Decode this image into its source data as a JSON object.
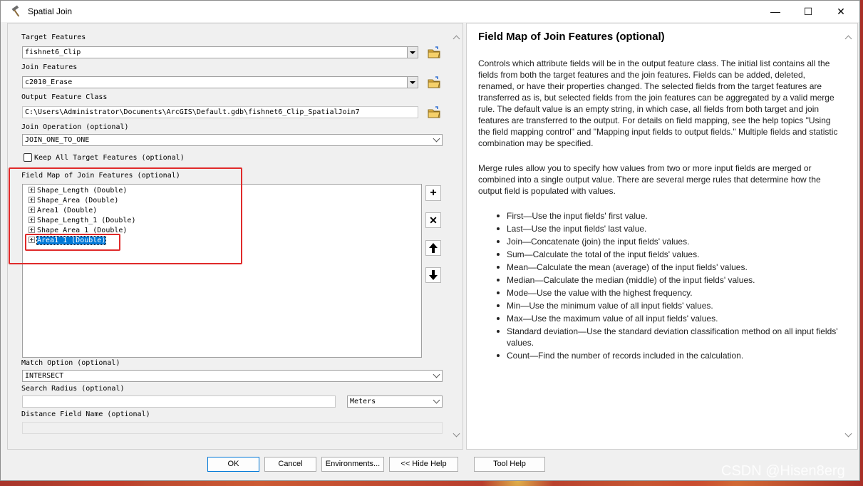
{
  "window": {
    "title": "Spatial Join",
    "controls": {
      "minimize": "—",
      "maximize": "☐",
      "close": "✕"
    }
  },
  "form": {
    "target_features": {
      "label": "Target Features",
      "value": "fishnet6_Clip"
    },
    "join_features": {
      "label": "Join Features",
      "value": "c2010_Erase"
    },
    "output_feature_class": {
      "label": "Output Feature Class",
      "value": "C:\\Users\\Administrator\\Documents\\ArcGIS\\Default.gdb\\fishnet6_Clip_SpatialJoin7"
    },
    "join_operation": {
      "label": "Join Operation (optional)",
      "value": "JOIN_ONE_TO_ONE"
    },
    "keep_all": {
      "label": "Keep All Target Features (optional)",
      "checked": false
    },
    "field_map": {
      "label": "Field Map of Join Features (optional)",
      "items": [
        {
          "text": "Shape_Length (Double)",
          "selected": false
        },
        {
          "text": "Shape_Area (Double)",
          "selected": false
        },
        {
          "text": "Area1 (Double)",
          "selected": false
        },
        {
          "text": "Shape_Length_1 (Double)",
          "selected": false
        },
        {
          "text": "Shape_Area_1 (Double)",
          "selected": false
        },
        {
          "text": "Area1_1 (Double)",
          "selected": true
        }
      ],
      "buttons": {
        "add": "+",
        "remove": "✕",
        "up": "🡅",
        "down": "🡇"
      }
    },
    "match_option": {
      "label": "Match Option (optional)",
      "value": "INTERSECT"
    },
    "search_radius": {
      "label": "Search Radius (optional)",
      "value": "",
      "unit": "Meters"
    },
    "distance_field": {
      "label": "Distance Field Name (optional)",
      "value": ""
    }
  },
  "help": {
    "title": "Field Map of Join Features (optional)",
    "para1": "Controls which attribute fields will be in the output feature class. The initial list contains all the fields from both the target features and the join features. Fields can be added, deleted, renamed, or have their properties changed. The selected fields from the target features are transferred as is, but selected fields from the join features can be aggregated by a valid merge rule. The default value is an empty string, in which case, all fields from both target and join features are transferred to the output. For details on field mapping, see the help topics \"Using the field mapping control\" and \"Mapping input fields to output fields.\" Multiple fields and statistic combination may be specified.",
    "para2": "Merge rules allow you to specify how values from two or more input fields are merged or combined into a single output value. There are several merge rules that determine how the output field is populated with values.",
    "rules": [
      "First—Use the input fields' first value.",
      "Last—Use the input fields' last value.",
      "Join—Concatenate (join) the input fields' values.",
      "Sum—Calculate the total of the input fields' values.",
      "Mean—Calculate the mean (average) of the input fields' values.",
      "Median—Calculate the median (middle) of the input fields' values.",
      "Mode—Use the value with the highest frequency.",
      "Min—Use the minimum value of all input fields' values.",
      "Max—Use the maximum value of all input fields' values.",
      "Standard deviation—Use the standard deviation classification method on all input fields' values.",
      "Count—Find the number of records included in the calculation."
    ]
  },
  "buttons": {
    "ok": "OK",
    "cancel": "Cancel",
    "environments": "Environments...",
    "hide_help": "<< Hide Help",
    "tool_help": "Tool Help"
  },
  "watermark": "CSDN @Hisen8erg",
  "colors": {
    "highlight": "#e02a2a",
    "selection": "#0078d7"
  }
}
